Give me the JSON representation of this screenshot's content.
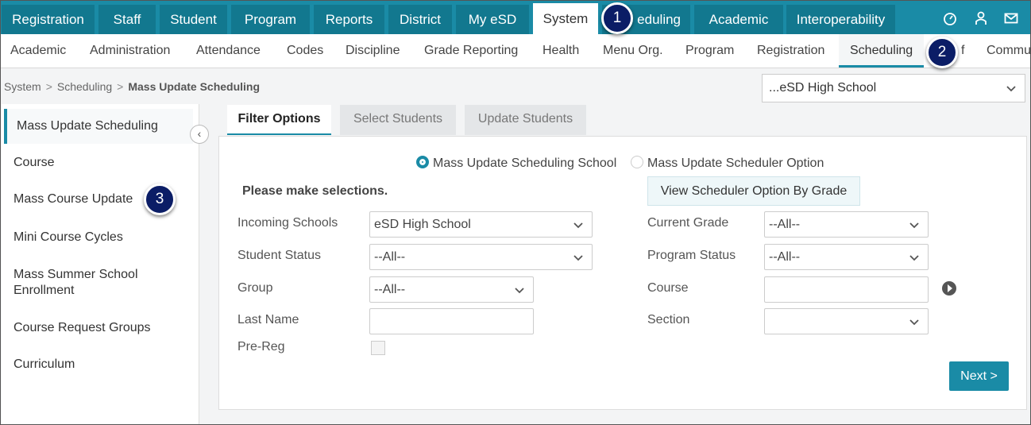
{
  "top_nav": {
    "tabs": [
      "Registration",
      "Staff",
      "Student",
      "Program",
      "Reports",
      "District",
      "My eSD",
      "System",
      "Scheduling",
      "Academic",
      "Interoperability"
    ],
    "active": "System",
    "visible_scheduling_fragment": "eduling"
  },
  "sub_nav": {
    "items": [
      "Academic",
      "Administration",
      "Attendance",
      "Codes",
      "Discipline",
      "Grade Reporting",
      "Health",
      "Menu Org.",
      "Program",
      "Registration",
      "Scheduling",
      "f",
      "Commu"
    ],
    "active": "Scheduling"
  },
  "breadcrumb": {
    "system": "System",
    "scheduling": "Scheduling",
    "current": "Mass Update Scheduling"
  },
  "school_select": {
    "value": "...eSD High School"
  },
  "sidebar": {
    "items": [
      "Mass Update Scheduling",
      "Course",
      "Mass Course Update",
      "Mini Course Cycles",
      "Mass Summer School Enrollment",
      "Course Request Groups",
      "Curriculum"
    ],
    "collapse_glyph": "‹"
  },
  "tabs": [
    "Filter Options",
    "Select Students",
    "Update Students"
  ],
  "radios": {
    "school": "Mass Update Scheduling School",
    "option": "Mass Update Scheduler Option",
    "selected": "school"
  },
  "form": {
    "heading": "Please make selections.",
    "view_button": "View Scheduler Option By Grade",
    "incoming_schools_label": "Incoming Schools",
    "incoming_schools_value": "eSD High School",
    "student_status_label": "Student Status",
    "student_status_value": "--All--",
    "group_label": "Group",
    "group_value": "--All--",
    "last_name_label": "Last Name",
    "pre_reg_label": "Pre-Reg",
    "current_grade_label": "Current Grade",
    "current_grade_value": "--All--",
    "program_status_label": "Program Status",
    "program_status_value": "--All--",
    "course_label": "Course",
    "section_label": "Section",
    "next_button": "Next >"
  },
  "badges": [
    "1",
    "2",
    "3"
  ],
  "colors": {
    "accent": "#1a8ba6",
    "tab_dark": "#12788f",
    "badge": "#0b1d66"
  },
  "icons": [
    "dashboard-icon",
    "user-icon",
    "mail-icon",
    "chevron-down-icon",
    "chevron-left-icon",
    "play-icon"
  ]
}
